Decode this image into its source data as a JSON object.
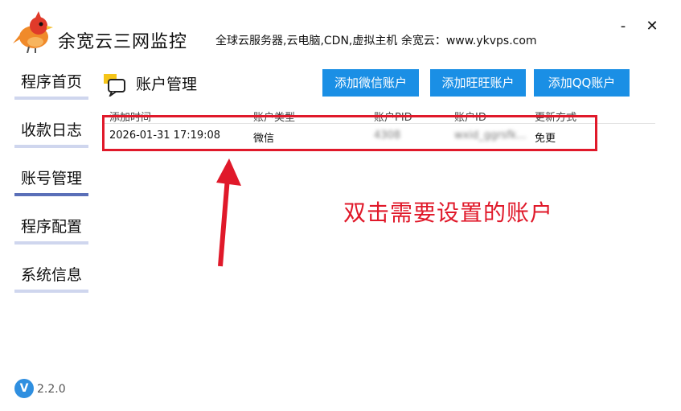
{
  "app": {
    "title": "余宽云三网监控",
    "slogan": "全球云服务器,云电脑,CDN,虚拟主机 余宽云：www.ykvps.com",
    "minimize": "-",
    "close": "✕"
  },
  "sidebar": {
    "items": [
      {
        "label": "程序首页"
      },
      {
        "label": "收款日志"
      },
      {
        "label": "账号管理",
        "active": true
      },
      {
        "label": "程序配置"
      },
      {
        "label": "系统信息"
      }
    ]
  },
  "section": {
    "title": "账户管理"
  },
  "buttons": {
    "add_wechat": "添加微信账户",
    "add_wangwang": "添加旺旺账户",
    "add_qq": "添加QQ账户"
  },
  "table": {
    "columns": [
      "添加时间",
      "账户类型",
      "账户PID",
      "账户ID",
      "更新方式"
    ],
    "rows": [
      [
        "2026-01-31 17:19:08",
        "微信",
        "4308",
        "wxid_ggrsfk...",
        "免更"
      ]
    ]
  },
  "annotation": {
    "instruction": "双击需要设置的账户",
    "color": "#e0192a"
  },
  "version": {
    "icon_letter": "V",
    "number": "2.2.0"
  },
  "colors": {
    "accent": "#1a8fe5",
    "nav_underline": "#cfd6ee",
    "nav_active": "#5a6fb8"
  }
}
